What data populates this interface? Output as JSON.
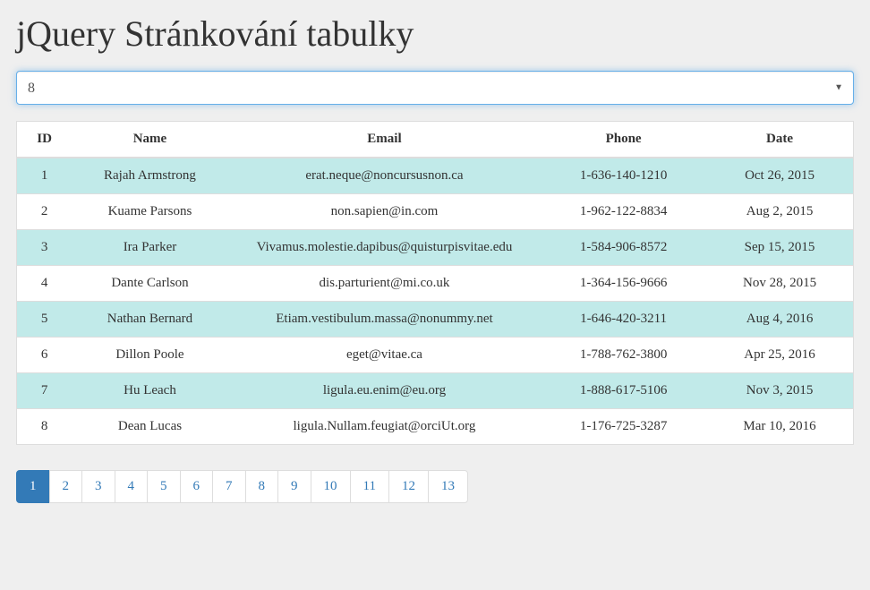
{
  "title": "jQuery Stránkování tabulky",
  "pageSize": {
    "selected": "8"
  },
  "table": {
    "headers": [
      "ID",
      "Name",
      "Email",
      "Phone",
      "Date"
    ],
    "rows": [
      {
        "id": "1",
        "name": "Rajah Armstrong",
        "email": "erat.neque@noncursusnon.ca",
        "phone": "1-636-140-1210",
        "date": "Oct 26, 2015"
      },
      {
        "id": "2",
        "name": "Kuame Parsons",
        "email": "non.sapien@in.com",
        "phone": "1-962-122-8834",
        "date": "Aug 2, 2015"
      },
      {
        "id": "3",
        "name": "Ira Parker",
        "email": "Vivamus.molestie.dapibus@quisturpisvitae.edu",
        "phone": "1-584-906-8572",
        "date": "Sep 15, 2015"
      },
      {
        "id": "4",
        "name": "Dante Carlson",
        "email": "dis.parturient@mi.co.uk",
        "phone": "1-364-156-9666",
        "date": "Nov 28, 2015"
      },
      {
        "id": "5",
        "name": "Nathan Bernard",
        "email": "Etiam.vestibulum.massa@nonummy.net",
        "phone": "1-646-420-3211",
        "date": "Aug 4, 2016"
      },
      {
        "id": "6",
        "name": "Dillon Poole",
        "email": "eget@vitae.ca",
        "phone": "1-788-762-3800",
        "date": "Apr 25, 2016"
      },
      {
        "id": "7",
        "name": "Hu Leach",
        "email": "ligula.eu.enim@eu.org",
        "phone": "1-888-617-5106",
        "date": "Nov 3, 2015"
      },
      {
        "id": "8",
        "name": "Dean Lucas",
        "email": "ligula.Nullam.feugiat@orciUt.org",
        "phone": "1-176-725-3287",
        "date": "Mar 10, 2016"
      }
    ]
  },
  "pagination": {
    "pages": [
      "1",
      "2",
      "3",
      "4",
      "5",
      "6",
      "7",
      "8",
      "9",
      "10",
      "11",
      "12",
      "13"
    ],
    "active": "1"
  }
}
